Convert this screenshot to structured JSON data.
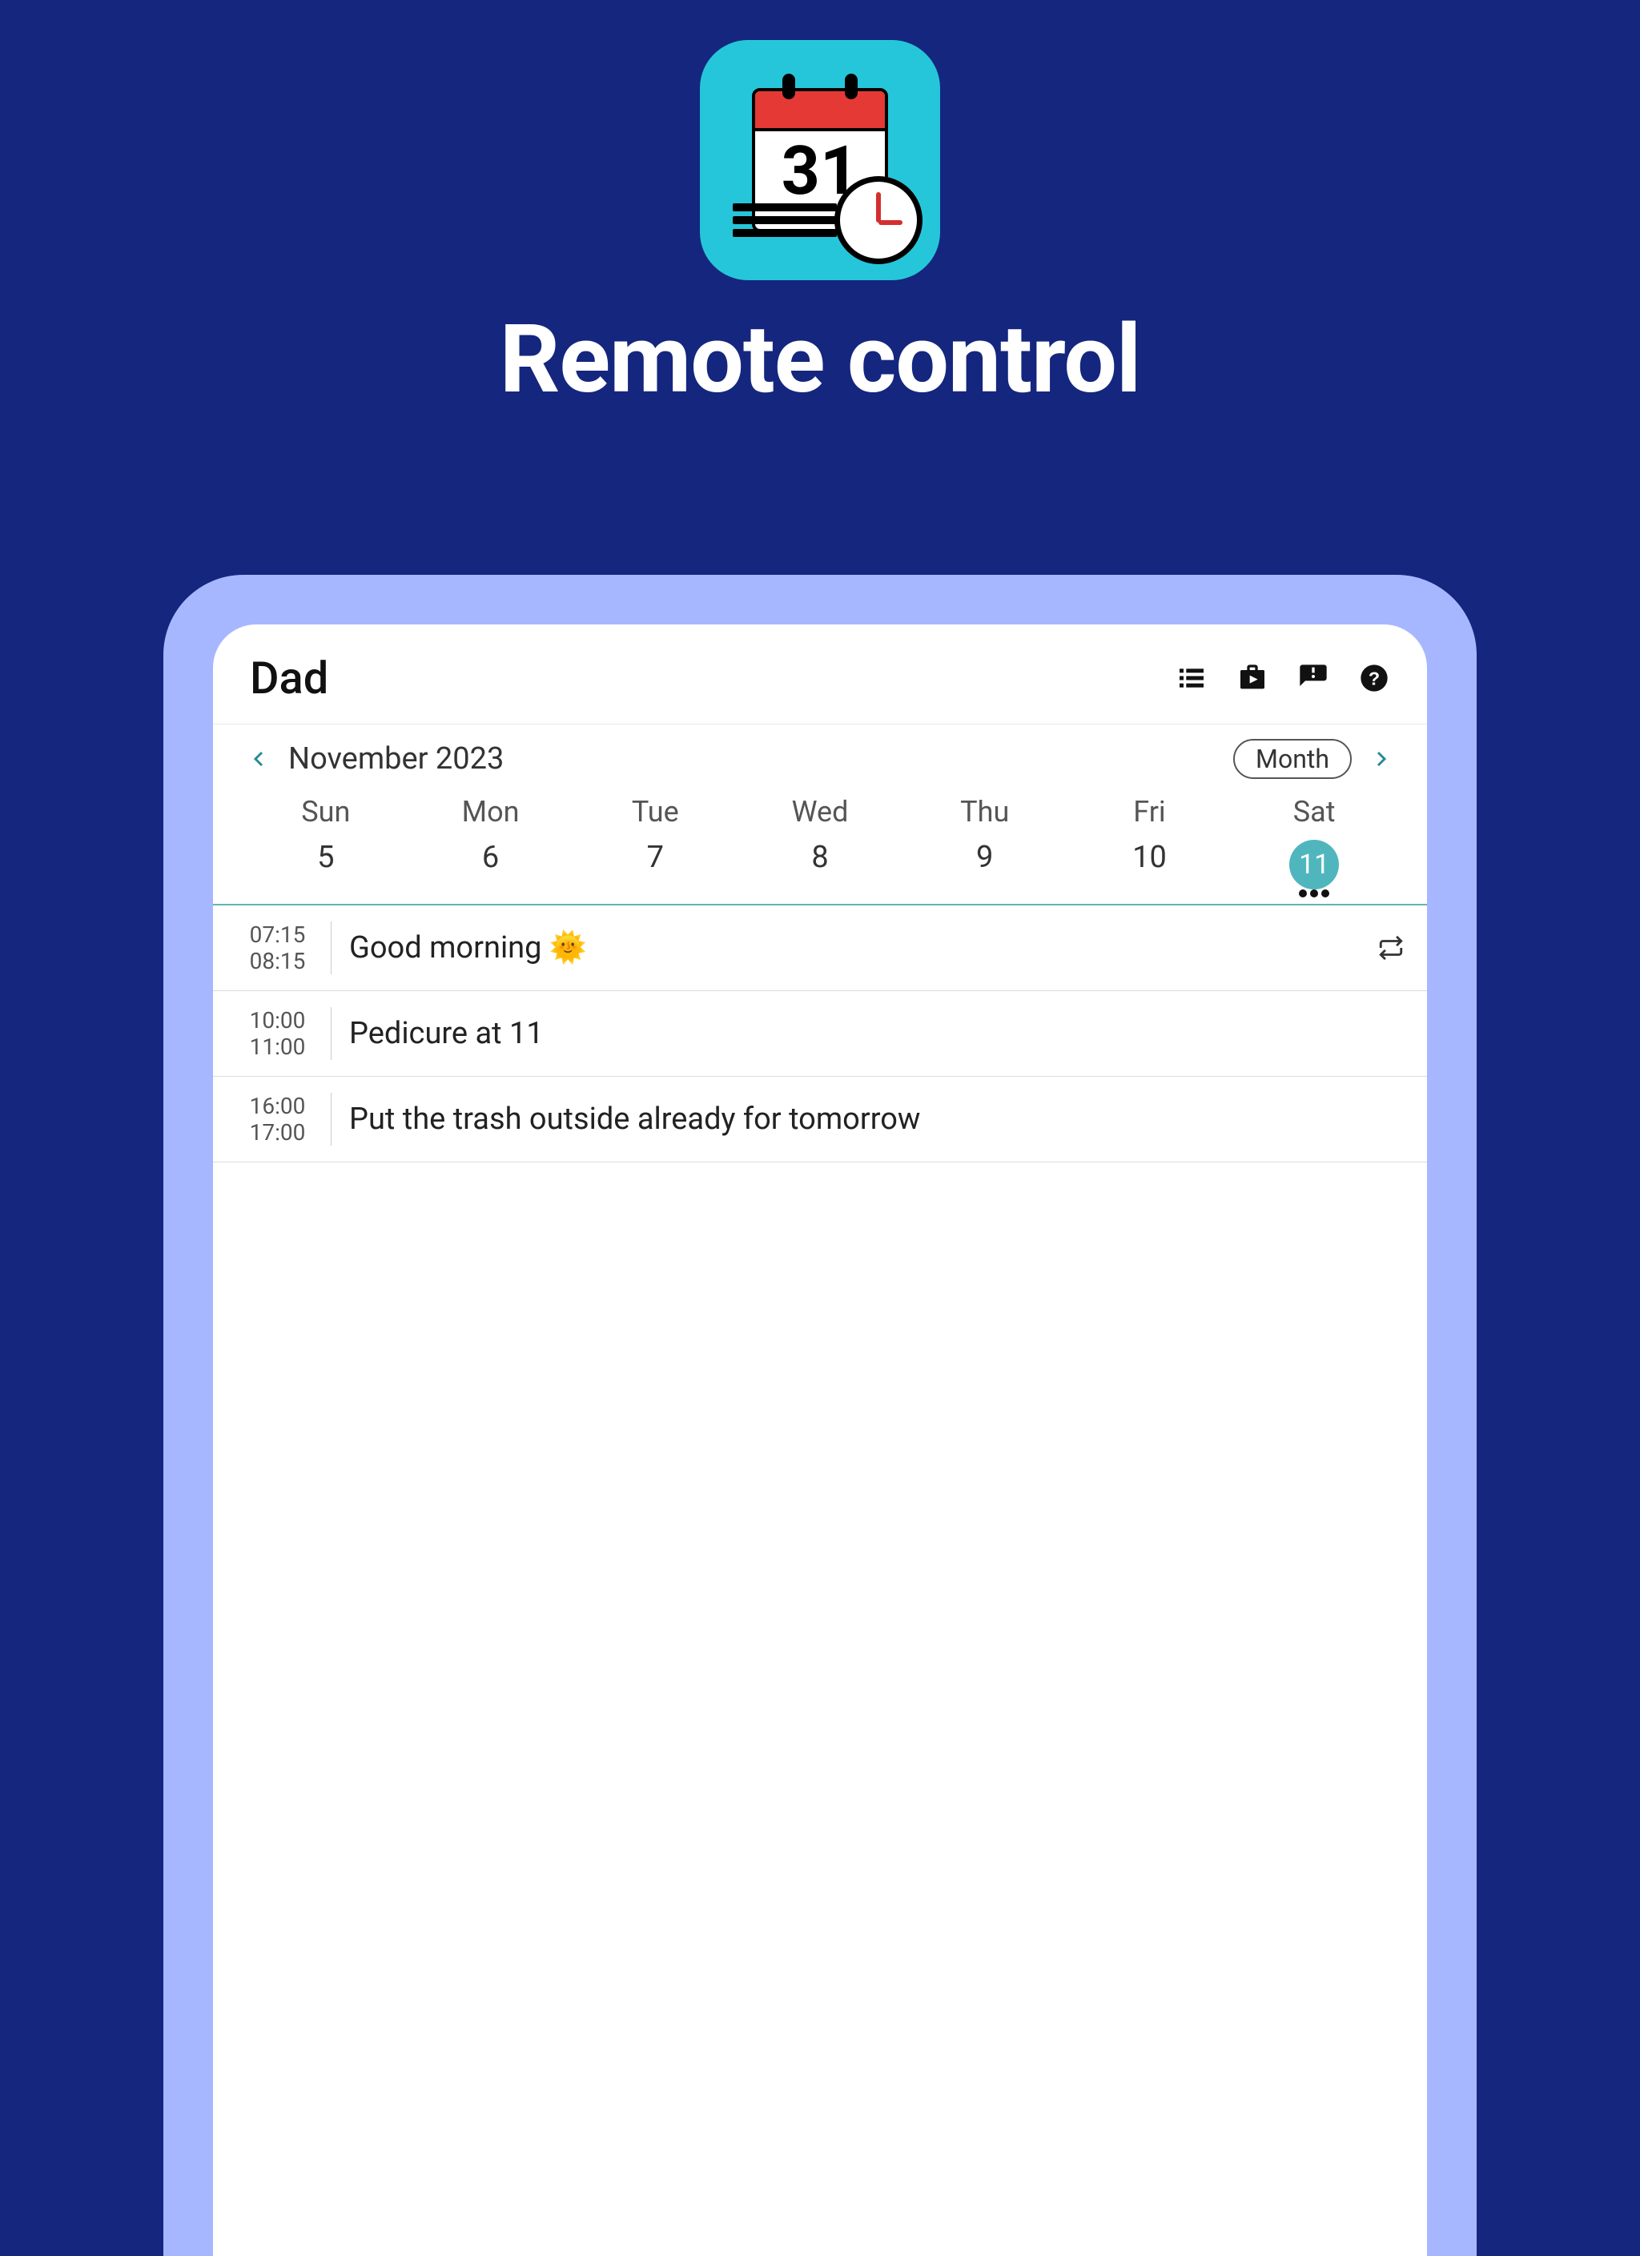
{
  "hero": {
    "title": "Remote control",
    "icon_date": "31"
  },
  "header": {
    "title": "Dad"
  },
  "nav": {
    "month_label": "November 2023",
    "view_label": "Month"
  },
  "days": [
    {
      "dow": "Sun",
      "num": "5",
      "selected": false
    },
    {
      "dow": "Mon",
      "num": "6",
      "selected": false
    },
    {
      "dow": "Tue",
      "num": "7",
      "selected": false
    },
    {
      "dow": "Wed",
      "num": "8",
      "selected": false
    },
    {
      "dow": "Thu",
      "num": "9",
      "selected": false
    },
    {
      "dow": "Fri",
      "num": "10",
      "selected": false
    },
    {
      "dow": "Sat",
      "num": "11",
      "selected": true
    }
  ],
  "events": [
    {
      "start": "07:15",
      "end": "08:15",
      "title": "Good morning 🌞",
      "repeat": true
    },
    {
      "start": "10:00",
      "end": "11:00",
      "title": "Pedicure at 11",
      "repeat": false
    },
    {
      "start": "16:00",
      "end": "17:00",
      "title": "Put the trash outside already for tomorrow",
      "repeat": false
    }
  ]
}
